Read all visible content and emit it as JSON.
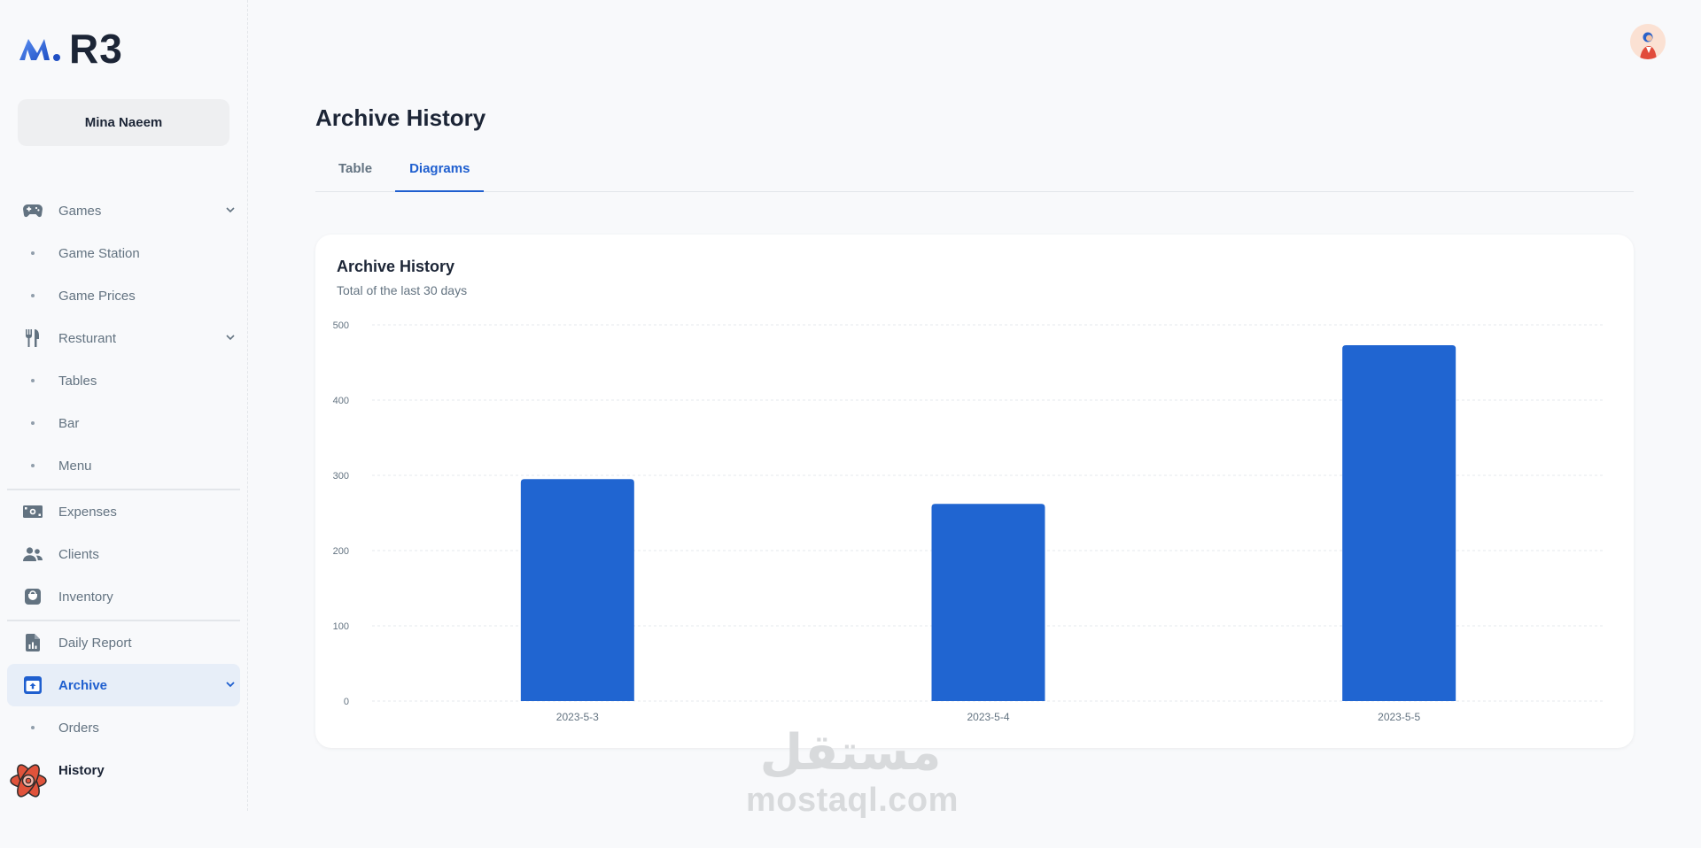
{
  "app": {
    "logo_text": "R3",
    "brand_color": "#1f5fcf"
  },
  "user": {
    "name": "Mina Naeem"
  },
  "sidebar": {
    "items": [
      {
        "label": "Games",
        "icon": "gamepad-icon",
        "expandable": true
      },
      {
        "label": "Game Station",
        "sub": true
      },
      {
        "label": "Game Prices",
        "sub": true
      },
      {
        "label": "Resturant",
        "icon": "utensils-icon",
        "expandable": true
      },
      {
        "label": "Tables",
        "sub": true
      },
      {
        "label": "Bar",
        "sub": true
      },
      {
        "label": "Menu",
        "sub": true
      },
      {
        "label": "Expenses",
        "icon": "money-icon"
      },
      {
        "label": "Clients",
        "icon": "users-icon"
      },
      {
        "label": "Inventory",
        "icon": "inventory-icon"
      },
      {
        "label": "Daily Report",
        "icon": "report-icon"
      },
      {
        "label": "Archive",
        "icon": "archive-icon",
        "expandable": true,
        "active": true
      },
      {
        "label": "Orders",
        "sub": true
      },
      {
        "label": "History",
        "sub": true,
        "current": true
      }
    ]
  },
  "page": {
    "title": "Archive History",
    "tabs": [
      {
        "label": "Table",
        "active": false
      },
      {
        "label": "Diagrams",
        "active": true
      }
    ]
  },
  "card": {
    "title": "Archive History",
    "subtitle": "Total of the last 30 days"
  },
  "chart_data": {
    "type": "bar",
    "categories": [
      "2023-5-3",
      "2023-5-4",
      "2023-5-5"
    ],
    "values": [
      295,
      262,
      473
    ],
    "ylim": [
      0,
      500
    ],
    "yticks": [
      0,
      100,
      200,
      300,
      400,
      500
    ],
    "color": "#2065d1",
    "grid": true
  },
  "watermark": {
    "arabic": "مستقل",
    "latin": "mostaql.com"
  }
}
